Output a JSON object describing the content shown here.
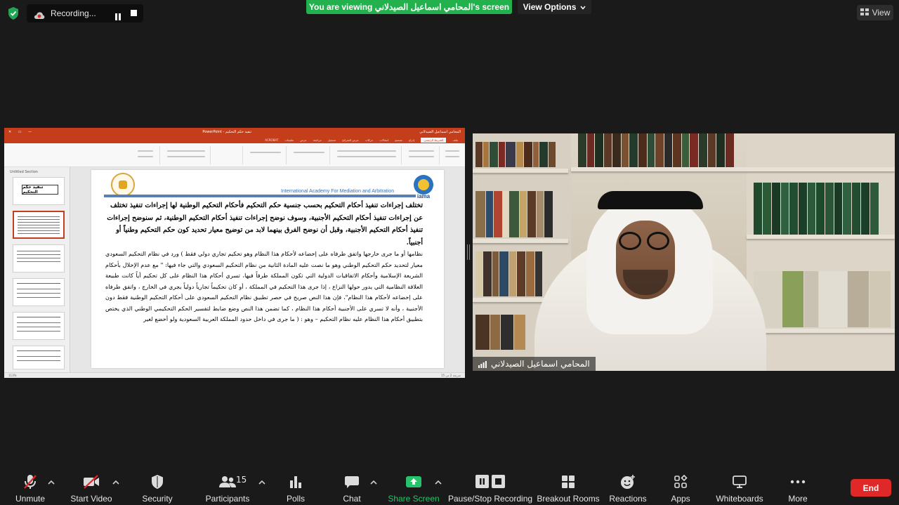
{
  "top": {
    "recording_label": "Recording...",
    "viewing_banner": "You are viewing المحامي اسماعيل الصيدلاني's screen",
    "view_options": "View Options",
    "view_button": "View"
  },
  "shared_screen": {
    "app_title": "PowerPoint - تنفيذ حكم التحكيم",
    "account_name": "المحامي اسماعيل الصيدلاني",
    "ribbon_tabs": [
      "ملف",
      "الشريط الرئيسي",
      "إدراج",
      "تصميم",
      "انتقالات",
      "حركات",
      "عرض الشرائح",
      "تسجيل",
      "مراجعة",
      "عرض",
      "تعليمات",
      "ACROBAT"
    ],
    "section_label": "Untitled Section",
    "thumb1_title": "تنفيذ حكم التحكيم",
    "slide": {
      "academy_name": "International Academy For Mediation and Arbitration",
      "logo_text": "iama",
      "bold_paragraph": "تختلف إجراءات تنفيذ أحكام التحكيم بحسب جنسية حكم التحكيم فأحكام التحكيم الوطنية لها إجراءات تنفيذ تختلف عن إجراءات تنفيذ أحكام التحكيم الأجنبية، وسوف نوضح إجراءات تنفيذ أحكام التحكيم الوطنية، ثم سنوضح إجراءات تنفيذ أحكام التحكيم الأجنبية، وقبل أن نوضح الفرق بينهما لابد من توضيح معيار تحديد كون حكم التحكيم وطنياً أو أجنبياً.",
      "body_paragraph": "نظامها أو ما جرى خارجها واتفق طرفاه على إخضاعه لأحكام هذا النظام وهو تحكيم تجاري دولي فقط ) ورد في نظام التحكيم السعودي معيار لتحديد حكم التحكيم الوطني وهو ما نصت عليه المادة الثانية من نظام التحكيم السعودي والتي جاء فيها: \" مع عدم الإخلال بأحكام الشريعة الإسلامية وأحكام الاتفاقيات الدولية التي تكون المملكة طرفاً فيها، تسري أحكام هذا النظام على كل تحكيم أياً كانت طبيعة العلاقة النظامية التي يدور حولها النزاع ، إذا جرى هذا التحكيم في المملكة ، أو كان تحكيماً تجارياً دولياً يجري في الخارج ، واتفق طرفاه على إخضاعه لأحكام هذا النظام\"، فإن هذا النص صريح في حصر تطبيق نظام التحكيم السعودي على أحكام التحكيم الوطنية فقط دون الأجنبية ، وأنه لا تسري على الأجنبية أحكام هذا النظام ، كما تضمن هذا النص وضع ضابط لتفسير الحكم التحكيمي الوطني الذي يختص بتطبيق أحكام هذا النظام عليه نظام التحكيم – وهو : ( ما جرى في داخل حدود المملكة العربية السعودية ولو أخضع لغير"
    },
    "status_left": "113%",
    "status_right": "شريحة 2 من 15"
  },
  "video": {
    "participant_name": "المحامي اسماعيل الصيدلاني"
  },
  "toolbar": {
    "unmute": "Unmute",
    "start_video": "Start Video",
    "security": "Security",
    "participants": "Participants",
    "participants_count": "15",
    "polls": "Polls",
    "chat": "Chat",
    "share_screen": "Share Screen",
    "pause_stop": "Pause/Stop Recording",
    "breakout": "Breakout Rooms",
    "reactions": "Reactions",
    "apps": "Apps",
    "whiteboards": "Whiteboards",
    "more": "More",
    "end": "End"
  },
  "colors": {
    "green_banner": "#22b14c",
    "share_green": "#26c36b",
    "end_red": "#e02828",
    "ppt_red": "#c43e1c"
  }
}
